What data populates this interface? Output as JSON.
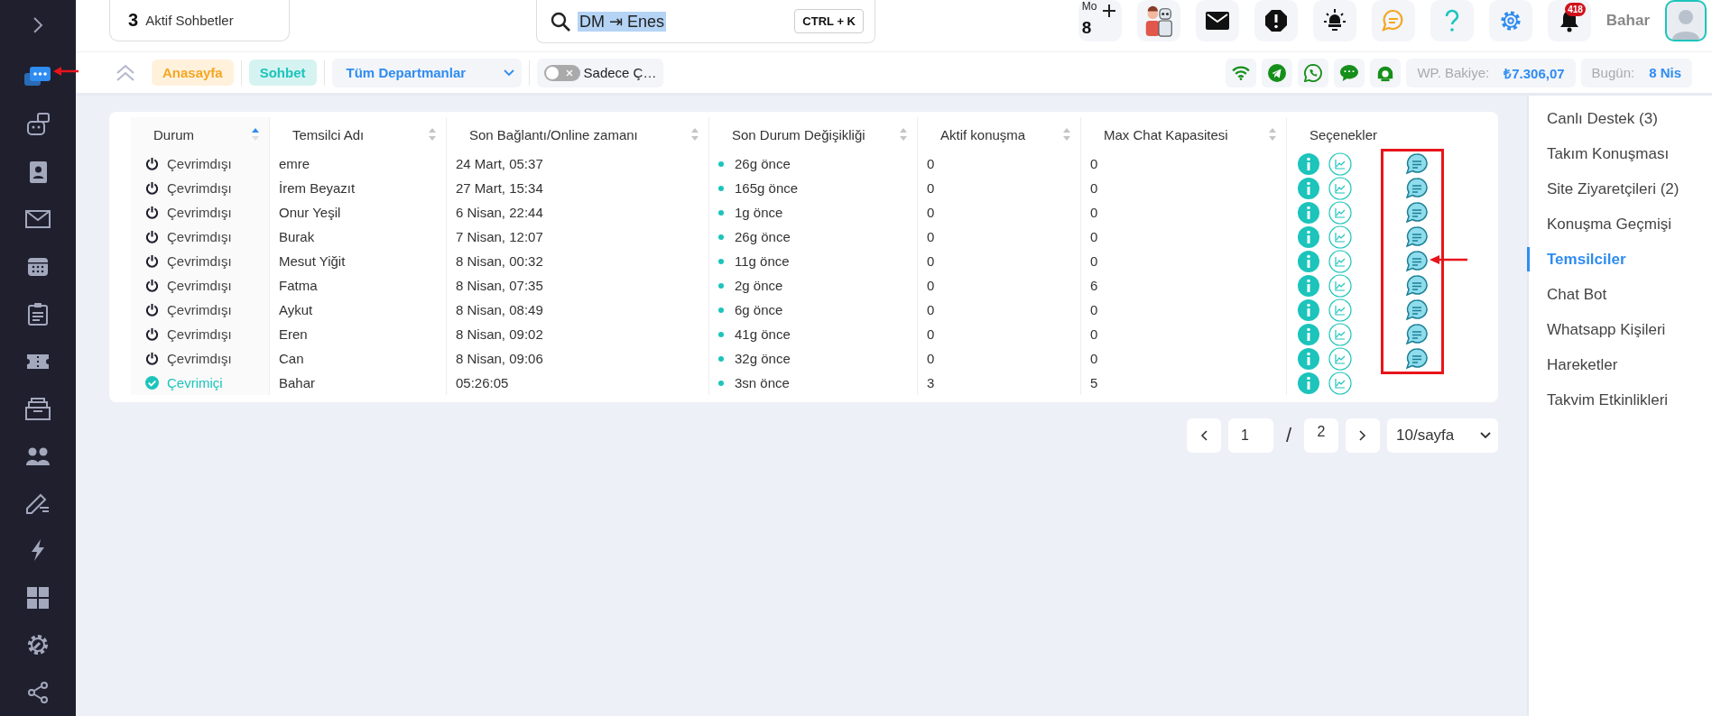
{
  "sidebar": {
    "items": [
      {
        "kind": "chat",
        "selected": true
      },
      {
        "kind": "robot",
        "selected": false
      },
      {
        "kind": "contacts",
        "selected": false
      },
      {
        "kind": "mail",
        "selected": false
      },
      {
        "kind": "calendar",
        "selected": false
      },
      {
        "kind": "clipboard",
        "selected": false
      },
      {
        "kind": "ticket",
        "selected": false
      },
      {
        "kind": "archive",
        "selected": false
      },
      {
        "kind": "users",
        "selected": false
      },
      {
        "kind": "edit",
        "selected": false
      },
      {
        "kind": "bolt",
        "selected": false
      },
      {
        "kind": "grid",
        "selected": false
      },
      {
        "kind": "settings",
        "selected": false
      },
      {
        "kind": "share",
        "selected": false
      }
    ]
  },
  "header": {
    "active_chats": {
      "count": "3",
      "label": "Aktif Sohbetler"
    },
    "search": {
      "value": "DM ⇥ Enes",
      "shortcut": "CTRL + K"
    },
    "counter": {
      "label": "Mo",
      "value": "8"
    },
    "notifications": "418",
    "user": "Bahar"
  },
  "toolbar": {
    "tags": [
      {
        "label": "Anasayfa",
        "kind": "home"
      },
      {
        "label": "Sohbet",
        "kind": "chat"
      }
    ],
    "department": "Tüm Departmanlar",
    "toggle": {
      "label": "Sadece Ç…",
      "on": false
    },
    "balance": {
      "label": "WP. Bakiye:",
      "value": "₺7.306,07"
    },
    "today": {
      "label": "Bugün:",
      "value": "8 Nis"
    }
  },
  "table": {
    "columns": [
      {
        "label": "Durum",
        "sortable": true,
        "sorted": true
      },
      {
        "label": "Temsilci Adı",
        "sortable": true,
        "sorted": false
      },
      {
        "label": "Son Bağlantı/Online zamanı",
        "sortable": true,
        "sorted": false
      },
      {
        "label": "Son Durum Değişikliği",
        "sortable": true,
        "sorted": false
      },
      {
        "label": "Aktif konuşma",
        "sortable": true,
        "sorted": false
      },
      {
        "label": "Max Chat Kapasitesi",
        "sortable": true,
        "sorted": false
      },
      {
        "label": "Seçenekler",
        "sortable": false
      }
    ],
    "rows": [
      {
        "status": "Çevrimdışı",
        "online": false,
        "name": "emre",
        "last_connection": "24 Mart, 05:37",
        "last_change": "26g önce",
        "active": "0",
        "max_capacity": "0",
        "chat": true
      },
      {
        "status": "Çevrimdışı",
        "online": false,
        "name": "İrem Beyazıt",
        "last_connection": "27 Mart, 15:34",
        "last_change": "165g önce",
        "active": "0",
        "max_capacity": "0",
        "chat": true
      },
      {
        "status": "Çevrimdışı",
        "online": false,
        "name": "Onur Yeşil",
        "last_connection": "6 Nisan, 22:44",
        "last_change": "1g önce",
        "active": "0",
        "max_capacity": "0",
        "chat": true
      },
      {
        "status": "Çevrimdışı",
        "online": false,
        "name": "Burak",
        "last_connection": "7 Nisan, 12:07",
        "last_change": "26g önce",
        "active": "0",
        "max_capacity": "0",
        "chat": true
      },
      {
        "status": "Çevrimdışı",
        "online": false,
        "name": "Mesut Yiğit",
        "last_connection": "8 Nisan, 00:32",
        "last_change": "11g önce",
        "active": "0",
        "max_capacity": "0",
        "chat": true
      },
      {
        "status": "Çevrimdışı",
        "online": false,
        "name": "Fatma",
        "last_connection": "8 Nisan, 07:35",
        "last_change": "2g önce",
        "active": "0",
        "max_capacity": "6",
        "chat": true
      },
      {
        "status": "Çevrimdışı",
        "online": false,
        "name": "Aykut",
        "last_connection": "8 Nisan, 08:49",
        "last_change": "6g önce",
        "active": "0",
        "max_capacity": "0",
        "chat": true
      },
      {
        "status": "Çevrimdışı",
        "online": false,
        "name": "Eren",
        "last_connection": "8 Nisan, 09:02",
        "last_change": "41g önce",
        "active": "0",
        "max_capacity": "0",
        "chat": true
      },
      {
        "status": "Çevrimdışı",
        "online": false,
        "name": "Can",
        "last_connection": "8 Nisan, 09:06",
        "last_change": "32g önce",
        "active": "0",
        "max_capacity": "0",
        "chat": true
      },
      {
        "status": "Çevrimiçi",
        "online": true,
        "name": "Bahar",
        "last_connection": "05:26:05",
        "last_change": "3sn önce",
        "active": "3",
        "max_capacity": "5",
        "chat": false
      }
    ]
  },
  "pagination": {
    "page": "1",
    "separator": "/",
    "total": "2",
    "page_size": "10/sayfa"
  },
  "nav": {
    "items": [
      {
        "label": "Canlı Destek (3)",
        "selected": false
      },
      {
        "label": "Takım Konuşması",
        "selected": false
      },
      {
        "label": "Site Ziyaretçileri (2)",
        "selected": false
      },
      {
        "label": "Konuşma Geçmişi",
        "selected": false
      },
      {
        "label": "Temsilciler",
        "selected": true
      },
      {
        "label": "Chat Bot",
        "selected": false
      },
      {
        "label": "Whatsapp Kişileri",
        "selected": false
      },
      {
        "label": "Hareketler",
        "selected": false
      },
      {
        "label": "Takvim Etkinlikleri",
        "selected": false
      }
    ]
  }
}
